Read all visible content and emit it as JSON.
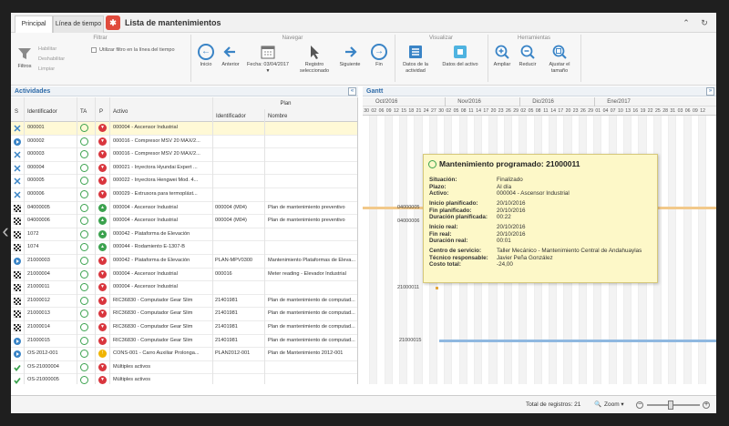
{
  "tabs": [
    {
      "label": "Principal",
      "active": true
    },
    {
      "label": "Línea de tiempo",
      "active": false
    }
  ],
  "app": {
    "title": "Lista de mantenimientos",
    "logo_icon": "app-logo-icon"
  },
  "window_controls": {
    "collapse_glyph": "⌃",
    "refresh_glyph": "↻"
  },
  "ribbon": {
    "groups": {
      "filtrar": "Filtrar",
      "navegar": "Navegar",
      "visualizar": "Visualizar",
      "herramientas": "Herramientas"
    },
    "filtrar": {
      "filtros_label": "Filtros",
      "habilitar": "Habilitar",
      "deshabilitar": "Deshabilitar",
      "limpiar": "Limpiar",
      "use_filter": "Utilizar filtro en la línea del tiempo"
    },
    "navegar": {
      "inicio": "Inicio",
      "anterior": "Anterior",
      "fecha_label": "Fecha:",
      "fecha_value": "03/04/2017",
      "registro_sel": "Registro seleccionado",
      "siguiente": "Siguiente",
      "fin": "Fin"
    },
    "visualizar": {
      "datos_actividad": "Datos de la actividad",
      "datos_activo": "Datos del activo"
    },
    "herramientas": {
      "ampliar": "Ampliar",
      "reducir": "Reducir",
      "ajustar": "Ajustar el tamaño"
    }
  },
  "actividades": {
    "title": "Actividades",
    "collapse_glyph": "«",
    "headers": {
      "s": "S",
      "identificador": "Identificador",
      "ta": "TA",
      "p": "P",
      "activo": "Activo",
      "plan": "Plan",
      "plan_id": "Identificador",
      "plan_nombre": "Nombre"
    },
    "rows": [
      {
        "id": "000001",
        "status": "split",
        "p": "red",
        "activo": "000004 - Ascensor Industrial",
        "plan_id": "",
        "plan_nombre": "",
        "selected": true
      },
      {
        "id": "000002",
        "status": "play",
        "p": "red",
        "activo": "000016 - Compresor MSV 20 MAX/2...",
        "plan_id": "",
        "plan_nombre": ""
      },
      {
        "id": "000003",
        "status": "split",
        "p": "red",
        "activo": "000016 - Compresor MSV 20 MAX/2...",
        "plan_id": "",
        "plan_nombre": ""
      },
      {
        "id": "000004",
        "status": "split",
        "p": "red",
        "activo": "000021 - Inyectora Hyundai Expert ...",
        "plan_id": "",
        "plan_nombre": ""
      },
      {
        "id": "000005",
        "status": "split",
        "p": "red",
        "activo": "000022 - Inyectora Hengwei Mod. 4...",
        "plan_id": "",
        "plan_nombre": ""
      },
      {
        "id": "000006",
        "status": "split",
        "p": "red",
        "activo": "000029 - Extrusora para termoplást...",
        "plan_id": "",
        "plan_nombre": ""
      },
      {
        "id": "04000005",
        "status": "flag",
        "p": "green",
        "activo": "000004 - Ascensor Industrial",
        "plan_id": "000004 (M04)",
        "plan_nombre": "Plan de mantenimiento preventivo"
      },
      {
        "id": "04000006",
        "status": "flag",
        "p": "green",
        "activo": "000004 - Ascensor Industrial",
        "plan_id": "000004 (M04)",
        "plan_nombre": "Plan de mantenimiento preventivo"
      },
      {
        "id": "1072",
        "status": "flag",
        "p": "green",
        "activo": "000042 - Plataforma de Elevación",
        "plan_id": "",
        "plan_nombre": ""
      },
      {
        "id": "1074",
        "status": "flag",
        "p": "green",
        "activo": "000044 - Rodamiento E-1307-B",
        "plan_id": "",
        "plan_nombre": ""
      },
      {
        "id": "21000003",
        "status": "play",
        "p": "red",
        "activo": "000042 - Plataforma de Elevación",
        "plan_id": "PLAN-MPV0300",
        "plan_nombre": "Mantenimiento Plataformas de Eleva..."
      },
      {
        "id": "21000004",
        "status": "flag",
        "p": "red",
        "activo": "000004 - Ascensor Industrial",
        "plan_id": "000016",
        "plan_nombre": "Meter reading - Elevador Industrial"
      },
      {
        "id": "21000011",
        "status": "flag",
        "p": "red",
        "activo": "000004 - Ascensor Industrial",
        "plan_id": "",
        "plan_nombre": ""
      },
      {
        "id": "21000012",
        "status": "flag",
        "p": "red",
        "activo": "RIC36830 - Computador Gear Slim",
        "plan_id": "21401981",
        "plan_nombre": "Plan de mantenimiento de computad..."
      },
      {
        "id": "21000013",
        "status": "flag",
        "p": "red",
        "activo": "RIC36830 - Computador Gear Slim",
        "plan_id": "21401981",
        "plan_nombre": "Plan de mantenimiento de computad..."
      },
      {
        "id": "21000014",
        "status": "flag",
        "p": "red",
        "activo": "RIC36830 - Computador Gear Slim",
        "plan_id": "21401981",
        "plan_nombre": "Plan de mantenimiento de computad..."
      },
      {
        "id": "21000015",
        "status": "play",
        "p": "red",
        "activo": "RIC36830 - Computador Gear Slim",
        "plan_id": "21401981",
        "plan_nombre": "Plan de mantenimiento de computad..."
      },
      {
        "id": "OS-2012-001",
        "status": "play",
        "p": "yellow",
        "activo": "CONS-001 - Carro Auxiliar Prolonga...",
        "plan_id": "PLAN2012-001",
        "plan_nombre": "Plan de Mantenimiento 2012-001"
      },
      {
        "id": "OS-21000004",
        "status": "check",
        "p": "red",
        "activo": "Múltiples activos",
        "plan_id": "",
        "plan_nombre": ""
      },
      {
        "id": "OS-21000005",
        "status": "check",
        "p": "red",
        "activo": "Múltiples activos",
        "plan_id": "",
        "plan_nombre": ""
      },
      {
        "id": "OS-21000006",
        "status": "check",
        "p": "red",
        "activo": "000028 - Sopladora automática HS",
        "plan_id": "",
        "plan_nombre": ""
      }
    ]
  },
  "gantt": {
    "title": "Gantt",
    "expand_glyph": "»",
    "months": [
      "Oct/2016",
      "Nov/2016",
      "Dic/2016",
      "Ene/2017"
    ],
    "days": [
      "30",
      "02",
      "06",
      "09",
      "12",
      "15",
      "18",
      "21",
      "24",
      "27",
      "30",
      "02",
      "05",
      "08",
      "11",
      "14",
      "17",
      "20",
      "23",
      "26",
      "29",
      "02",
      "05",
      "08",
      "11",
      "14",
      "17",
      "20",
      "23",
      "26",
      "29",
      "01",
      "04",
      "07",
      "10",
      "13",
      "16",
      "19",
      "22",
      "25",
      "28",
      "31",
      "03",
      "06",
      "09",
      "12"
    ],
    "labels": {
      "r7": "04000005",
      "r8": "04000006",
      "r13": "21000011",
      "r17": "21000015"
    }
  },
  "tooltip": {
    "title": "Mantenimiento programado: 21000011",
    "rows": [
      {
        "k": "Situación:",
        "v": "Finalizado"
      },
      {
        "k": "Plazo:",
        "v": "Al día"
      },
      {
        "k": "Activo:",
        "v": "000004 - Ascensor Industrial"
      },
      {
        "k": "Inicio planificado:",
        "v": "20/10/2016"
      },
      {
        "k": "Fin planificado:",
        "v": "20/10/2016"
      },
      {
        "k": "Duración planificada:",
        "v": "00:22"
      },
      {
        "k": "Inicio real:",
        "v": "20/10/2016"
      },
      {
        "k": "Fin real:",
        "v": "20/10/2016"
      },
      {
        "k": "Duración real:",
        "v": "00:01"
      },
      {
        "k": "Centro de servicio:",
        "v": "Taller Mecánico - Mantenimiento Central de Andahuaylas"
      },
      {
        "k": "Técnico responsable:",
        "v": "Javier Peña González"
      },
      {
        "k": "Costo total:",
        "v": "-24,00"
      }
    ]
  },
  "footer": {
    "total_label": "Total de registros: 21",
    "zoom_label": "Zoom",
    "zoom_minus": "−",
    "zoom_plus": "+",
    "zoom_level": 0.45
  },
  "colors": {
    "accent": "#3a84c6",
    "red": "#d9363e",
    "green": "#3ba24e",
    "yellow": "#f0b400",
    "tooltip_bg": "#fdf8c8"
  }
}
